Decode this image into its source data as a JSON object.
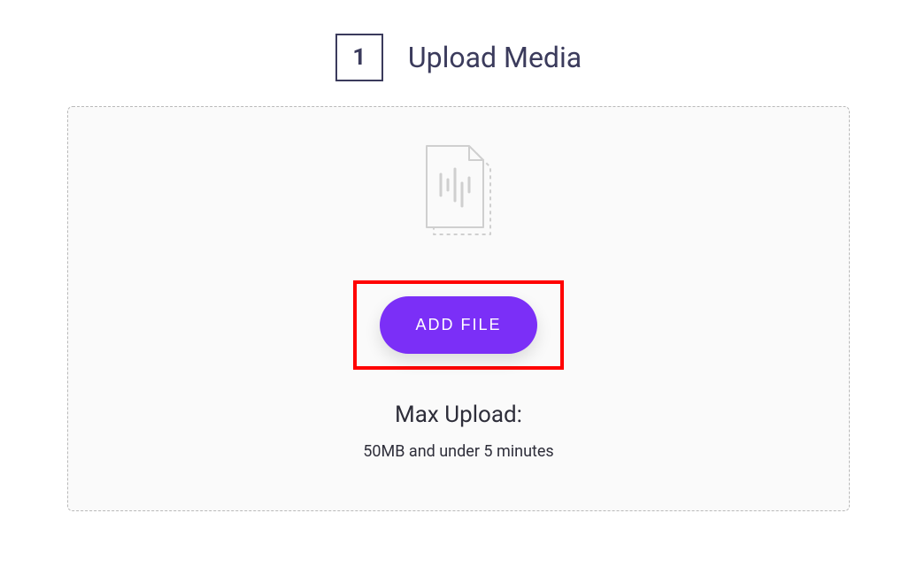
{
  "step": {
    "number": "1",
    "title": "Upload Media"
  },
  "dropzone": {
    "button_label": "ADD FILE",
    "limits_title": "Max Upload:",
    "limits_detail": "50MB and under 5 minutes"
  },
  "colors": {
    "accent": "#7b2ff7",
    "highlight": "#ff0000",
    "text_dark": "#3b3b5c"
  }
}
